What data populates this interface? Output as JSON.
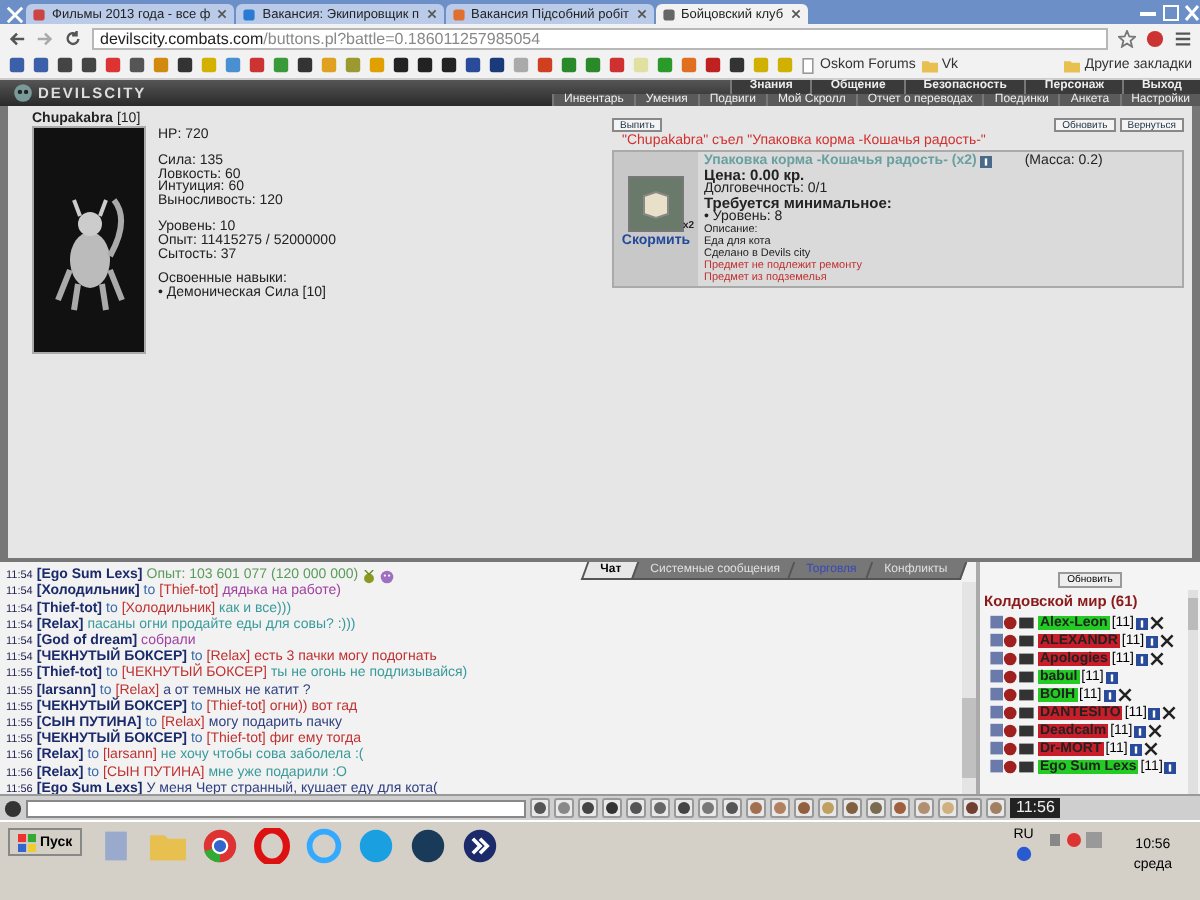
{
  "browser": {
    "tabs": [
      {
        "title": "Фильмы 2013 года - все ф",
        "selected": false
      },
      {
        "title": "Вакансия: Экипировщик п",
        "selected": false
      },
      {
        "title": "Вакансия Підсобний робіт",
        "selected": false
      },
      {
        "title": "Бойцовский клуб",
        "selected": true
      }
    ],
    "address": {
      "host": "devilscity.combats.com",
      "path": "/buttons.pl?battle=0.186011257985054"
    },
    "bookmarks": [
      "Oskom Forums",
      "Vk"
    ],
    "other_bookmarks": "Другие закладки"
  },
  "game": {
    "logo": "DEVILSCITY",
    "menu_top": [
      "Знания",
      "Общение",
      "Безопасность",
      "Персонаж",
      "Выход"
    ],
    "menu_bottom": [
      "Инвентарь",
      "Умения",
      "Подвиги",
      "Мой Скролл",
      "Отчет о переводах",
      "Поединки",
      "Анкета",
      "Настройки"
    ],
    "character": {
      "name": "Chupakabra",
      "level": "[10]",
      "stat_groups": [
        [
          "HP: 720"
        ],
        [
          "Сила: 135",
          "Ловкость: 60",
          "Интуиция: 60",
          "Выносливость: 120"
        ],
        [
          "Уровень: 10",
          "Опыт: 11415275 / 52000000",
          "Сытость: 37"
        ],
        [
          "Освоенные навыки:",
          "• Демоническая Сила [10]"
        ]
      ]
    },
    "item_view": {
      "buttons_left": [
        "Выпить"
      ],
      "buttons_right": [
        "Обновить",
        "Вернуться"
      ],
      "message": "\"Chupakabra\" съел \"Упаковка корма -Кошачья радость-\"",
      "item": {
        "title": "Упаковка корма -Кошачья радость- (x2)",
        "weight": "(Масса: 0.2)",
        "count_badge": "x2",
        "action": "Скормить",
        "lines": [
          {
            "kind": "bold",
            "text": "Цена: 0.00 кр."
          },
          {
            "kind": "normal",
            "text": "Долговечность: 0/1"
          },
          {
            "kind": "bold",
            "text": "Требуется минимальное:"
          },
          {
            "kind": "normal",
            "text": "• Уровень: 8"
          },
          {
            "kind": "small",
            "text": "Описание:"
          },
          {
            "kind": "small",
            "text": "Еда для кота"
          },
          {
            "kind": "small",
            "text": "Сделано в Devils city"
          },
          {
            "kind": "warning",
            "text": "Предмет не подлежит ремонту"
          },
          {
            "kind": "warning",
            "text": "Предмет из подземелья"
          }
        ]
      }
    }
  },
  "chat": {
    "tabs": [
      {
        "label": "Чат",
        "selected": true,
        "color": "#000000"
      },
      {
        "label": "Системные сообщения",
        "selected": false,
        "color": "#e0e0e0"
      },
      {
        "label": "Торговля",
        "selected": false,
        "color": "#3848b8"
      },
      {
        "label": "Конфликты",
        "selected": false,
        "color": "#e0e0e0"
      }
    ],
    "messages": [
      {
        "kind": "experience",
        "time": "11:54",
        "sender": "[Ego Sum Lexs]",
        "text": "Опыт: 103 601 077 (120 000 000)",
        "color": "#5a9a5a"
      },
      {
        "kind": "message",
        "time": "11:54",
        "sender": "[Холодильник]",
        "to": "to",
        "recipient": "[Thief-tot]",
        "text": "дядька на работе)",
        "color": "#a040a0"
      },
      {
        "kind": "message",
        "time": "11:54",
        "sender": "[Thief-tot]",
        "to": "to",
        "recipient": "[Холодильник]",
        "text": "как и все)))",
        "color": "#3a9a9a"
      },
      {
        "kind": "message",
        "time": "11:54",
        "sender": "[Relax]",
        "text": "пасаны огни продайте еды для совы? :)))",
        "color": "#3a9a9a"
      },
      {
        "kind": "message",
        "time": "11:54",
        "sender": "[God of dream]",
        "text": "собрали",
        "color": "#a040a0"
      },
      {
        "kind": "message",
        "time": "11:54",
        "sender": "[ЧЕКНУТЫЙ БОКСЕР]",
        "to": "to",
        "recipient": "[Relax]",
        "text": "есть 3 пачки могу подогнать",
        "color": "#c03030"
      },
      {
        "kind": "message",
        "time": "11:55",
        "sender": "[Thief-tot]",
        "to": "to",
        "recipient": "[ЧЕКНУТЫЙ БОКСЕР]",
        "text": "ты не огонь не подлизывайся)",
        "color": "#3a9a9a"
      },
      {
        "kind": "message",
        "time": "11:55",
        "sender": "[larsann]",
        "to": "to",
        "recipient": "[Relax]",
        "text": "а от темных не катит ?",
        "color": "#304080"
      },
      {
        "kind": "message",
        "time": "11:55",
        "sender": "[ЧЕКНУТЫЙ БОКСЕР]",
        "to": "to",
        "recipient": "[Thief-tot]",
        "text": "огни)) вот гад",
        "color": "#c03030"
      },
      {
        "kind": "message",
        "time": "11:55",
        "sender": "[СЫН ПУТИНА]",
        "to": "to",
        "recipient": "[Relax]",
        "text": "могу подарить пачку",
        "color": "#304080"
      },
      {
        "kind": "message",
        "time": "11:55",
        "sender": "[ЧЕКНУТЫЙ БОКСЕР]",
        "to": "to",
        "recipient": "[Thief-tot]",
        "text": "фиг ему тогда",
        "color": "#c03030"
      },
      {
        "kind": "message",
        "time": "11:56",
        "sender": "[Relax]",
        "to": "to",
        "recipient": "[larsann]",
        "text": "не хочу чтобы сова заболела :(",
        "color": "#3a9a9a"
      },
      {
        "kind": "message",
        "time": "11:56",
        "sender": "[Relax]",
        "to": "to",
        "recipient": "[СЫН ПУТИНА]",
        "text": "мне уже подарили :О",
        "color": "#3a9a9a"
      },
      {
        "kind": "message",
        "time": "11:56",
        "sender": "[Ego Sum Lexs]",
        "text": "У меня Черт странный, кушает еду для кота(",
        "color": "#304080"
      }
    ]
  },
  "online": {
    "refresh": "Обновить",
    "title": "Колдовской мир (61)",
    "players": [
      {
        "name": "Alex-Leon",
        "level": "[11]",
        "color": "#22cc22",
        "crossed": true
      },
      {
        "name": "ALEXANDR",
        "level": "[11]",
        "color": "#c81e2a",
        "crossed": true
      },
      {
        "name": "Apologies",
        "level": "[11]",
        "color": "#c81e2a",
        "crossed": true
      },
      {
        "name": "babul",
        "level": "[11]",
        "color": "#22cc22",
        "crossed": false
      },
      {
        "name": "BOIH",
        "level": "[11]",
        "color": "#22cc22",
        "crossed": true
      },
      {
        "name": "DANTESITO",
        "level": "[11]",
        "color": "#c81e2a",
        "crossed": true
      },
      {
        "name": "Deadcalm",
        "level": "[11]",
        "color": "#c81e2a",
        "crossed": true
      },
      {
        "name": "Dr-MORT",
        "level": "[11]",
        "color": "#c81e2a",
        "crossed": true
      },
      {
        "name": "Ego Sum Lexs",
        "level": "[11]",
        "color": "#22cc22",
        "crossed": false
      }
    ]
  },
  "chat_input": {
    "clock": "11:56"
  },
  "taskbar": {
    "start": "Пуск",
    "language": "RU",
    "time": "10:56",
    "day": "среда"
  }
}
